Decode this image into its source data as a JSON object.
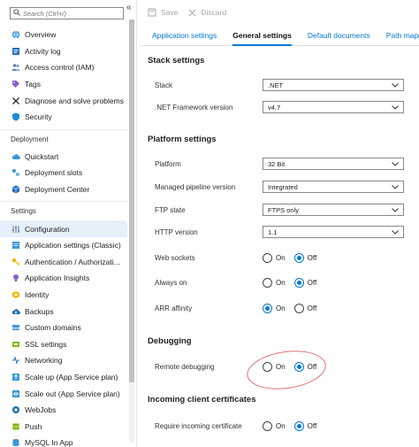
{
  "sidebar": {
    "search_placeholder": "Search (Ctrl+/)",
    "collapse_label": "«",
    "items_top": [
      {
        "label": "Overview",
        "icon": "globe-icon"
      },
      {
        "label": "Activity log",
        "icon": "activity-log-icon"
      },
      {
        "label": "Access control (IAM)",
        "icon": "people-icon"
      },
      {
        "label": "Tags",
        "icon": "tag-icon"
      },
      {
        "label": "Diagnose and solve problems",
        "icon": "wrench-icon"
      },
      {
        "label": "Security",
        "icon": "shield-icon"
      }
    ],
    "section_deployment": "Deployment",
    "items_deployment": [
      {
        "label": "Quickstart",
        "icon": "cloud-icon"
      },
      {
        "label": "Deployment slots",
        "icon": "slots-icon"
      },
      {
        "label": "Deployment Center",
        "icon": "cube-icon"
      }
    ],
    "section_settings": "Settings",
    "items_settings": [
      {
        "label": "Configuration",
        "icon": "sliders-icon"
      },
      {
        "label": "Application settings (Classic)",
        "icon": "app-settings-icon"
      },
      {
        "label": "Authentication / Authorizati...",
        "icon": "key-icon"
      },
      {
        "label": "Application Insights",
        "icon": "lightbulb-icon"
      },
      {
        "label": "Identity",
        "icon": "identity-icon"
      },
      {
        "label": "Backups",
        "icon": "backup-icon"
      },
      {
        "label": "Custom domains",
        "icon": "domain-icon"
      },
      {
        "label": "SSL settings",
        "icon": "ssl-icon"
      },
      {
        "label": "Networking",
        "icon": "network-icon"
      },
      {
        "label": "Scale up (App Service plan)",
        "icon": "scale-up-icon"
      },
      {
        "label": "Scale out (App Service plan)",
        "icon": "scale-out-icon"
      },
      {
        "label": "WebJobs",
        "icon": "webjobs-icon"
      },
      {
        "label": "Push",
        "icon": "push-icon"
      },
      {
        "label": "MySQL In App",
        "icon": "mysql-icon"
      }
    ]
  },
  "toolbar": {
    "save_label": "Save",
    "discard_label": "Discard"
  },
  "tabs": [
    {
      "label": "Application settings"
    },
    {
      "label": "General settings"
    },
    {
      "label": "Default documents"
    },
    {
      "label": "Path mappings"
    }
  ],
  "stack": {
    "title": "Stack settings",
    "stack_label": "Stack",
    "stack_value": ".NET",
    "framework_label": ".NET Framework version",
    "framework_value": "v4.7"
  },
  "platform": {
    "title": "Platform settings",
    "platform_label": "Platform",
    "platform_value": "32 Bit",
    "pipeline_label": "Managed pipeline version",
    "pipeline_value": "Integrated",
    "ftp_label": "FTP state",
    "ftp_value": "FTPS only",
    "http_label": "HTTP version",
    "http_value": "1.1",
    "websockets_label": "Web sockets",
    "alwayson_label": "Always on",
    "arr_label": "ARR affinity"
  },
  "debugging": {
    "title": "Debugging",
    "remote_label": "Remote debugging"
  },
  "certs": {
    "title": "Incoming client certificates",
    "require_label": "Require incoming certificate"
  },
  "radio": {
    "on": "On",
    "off": "Off"
  },
  "colors": {
    "accent": "#0078d4",
    "annotation": "#e07070"
  }
}
